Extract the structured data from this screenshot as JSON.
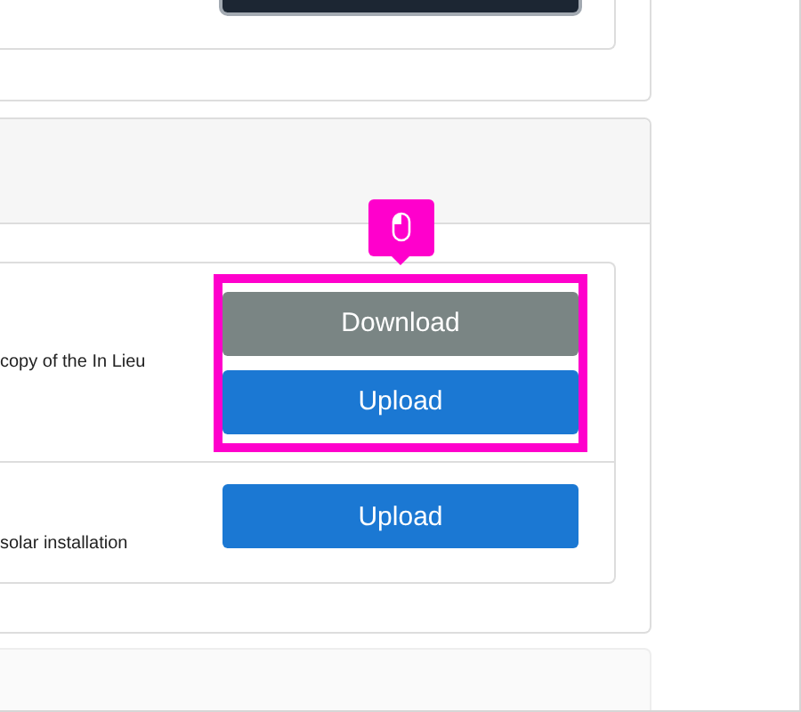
{
  "documents": [
    {
      "description": "copy of the In Lieu",
      "highlighted": true,
      "buttons": [
        {
          "label": "Download",
          "kind": "secondary"
        },
        {
          "label": "Upload",
          "kind": "primary"
        }
      ]
    },
    {
      "description": "solar installation",
      "highlighted": false,
      "buttons": [
        {
          "label": "Upload",
          "kind": "primary"
        }
      ]
    }
  ]
}
